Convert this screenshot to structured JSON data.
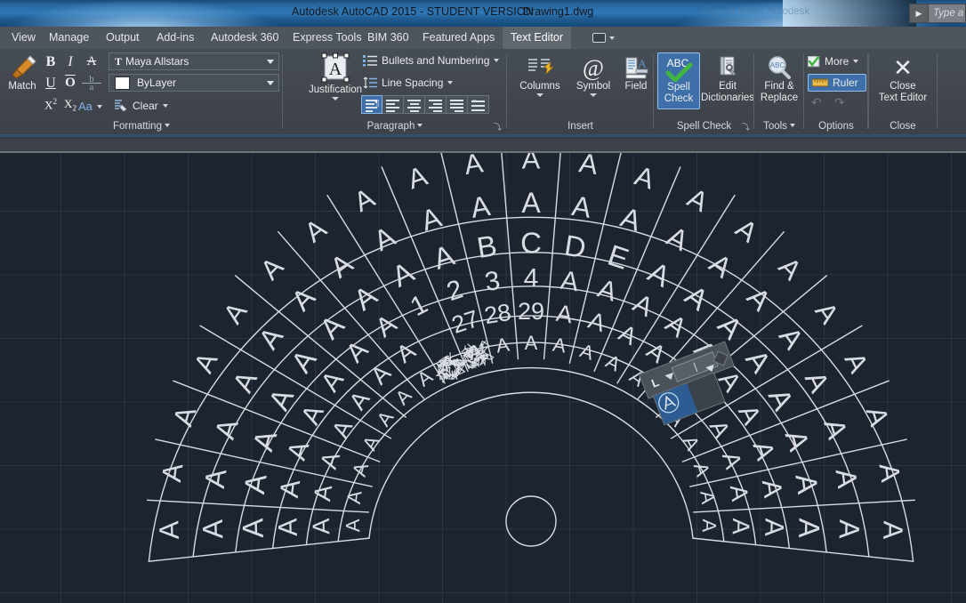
{
  "titlebar": {
    "app_title": "Autodesk AutoCAD 2015 - STUDENT VERSION",
    "document": "Drawing1.dwg",
    "ghost_text": "Sign In   Share   Autodesk",
    "search_placeholder": "Type a keyword or phrase",
    "expand_arrow": "▶"
  },
  "tabs": [
    {
      "label": "View",
      "active": false
    },
    {
      "label": "Manage",
      "active": false
    },
    {
      "label": "Output",
      "active": false
    },
    {
      "label": "Add-ins",
      "active": false
    },
    {
      "label": "Autodesk 360",
      "active": false
    },
    {
      "label": "Express Tools",
      "active": false
    },
    {
      "label": "BIM 360",
      "active": false
    },
    {
      "label": "Featured Apps",
      "active": false
    },
    {
      "label": "Text Editor",
      "active": true
    }
  ],
  "panels": {
    "formatting": {
      "title": "Formatting",
      "match_label": "Match",
      "bold": "B",
      "italic": "I",
      "strikethrough": "A",
      "underline": "U",
      "overline": "O",
      "stack": "b/a",
      "superscript_base": "X",
      "superscript_exp": "2",
      "subscript_base": "X",
      "subscript_exp": "2",
      "case_label": "Aa",
      "clear_label": "Clear",
      "font_value": "Maya Allstars",
      "font_icon": "T",
      "color_value": "ByLayer",
      "color_swatch": "#ffffff"
    },
    "paragraph": {
      "title": "Paragraph",
      "justification_label": "Justification",
      "justification_glyph": "A",
      "bullets_label": "Bullets and Numbering",
      "line_spacing_label": "Line Spacing",
      "align_buttons": [
        {
          "name": "justification-combined",
          "selected": true
        },
        {
          "name": "align-left",
          "selected": false
        },
        {
          "name": "align-center",
          "selected": false
        },
        {
          "name": "align-right",
          "selected": false
        },
        {
          "name": "align-justify",
          "selected": false
        },
        {
          "name": "align-distributed",
          "selected": false
        }
      ],
      "dialog_launcher": "⤵"
    },
    "insert": {
      "title": "Insert",
      "items": [
        {
          "label": "Columns",
          "icon": "columns-icon",
          "has_caret": true
        },
        {
          "label": "Symbol",
          "icon": "at-symbol-icon",
          "glyph": "@",
          "has_caret": true
        },
        {
          "label": "Field",
          "icon": "field-icon",
          "has_caret": false
        }
      ]
    },
    "spellcheck": {
      "title": "Spell Check",
      "spell_line1": "Spell",
      "spell_line2": "Check",
      "spell_badge": "ABC",
      "spell_tick": "✓",
      "spell_active": true,
      "dict_line1": "Edit",
      "dict_line2": "Dictionaries",
      "dialog_launcher": "⤵"
    },
    "tools": {
      "title": "Tools",
      "find_line1": "Find &",
      "find_line2": "Replace",
      "find_badge": "ABC"
    },
    "options": {
      "title": "Options",
      "more_label": "More",
      "ruler_label": "Ruler",
      "ruler_active": true,
      "undo_glyph": "↶",
      "redo_glyph": "↷"
    },
    "close": {
      "title": "Close",
      "line1": "Close",
      "line2": "Text Editor",
      "glyph": "✕"
    }
  },
  "canvas": {
    "background": "#1d2430",
    "grid_color": "#2b3544",
    "geometry_color": "#d8dde3",
    "center_circle": true,
    "rings": [
      {
        "index": 0,
        "labels": [
          "A",
          "A",
          "A",
          "A",
          "A",
          "A",
          "A",
          "A",
          "A",
          "A",
          "A",
          "A",
          "A",
          "A",
          "A",
          "A",
          "A",
          "A",
          "A",
          "A",
          "A"
        ]
      },
      {
        "index": 1,
        "labels": [
          "A",
          "A",
          "A",
          "A",
          "A",
          "A",
          "A",
          "░",
          "27",
          "28",
          "29",
          "A",
          "A",
          "A",
          "A",
          "A",
          "A",
          "A",
          "A",
          "A",
          "A"
        ]
      },
      {
        "index": 2,
        "labels": [
          "A",
          "A",
          "A",
          "A",
          "A",
          "A",
          "A",
          "1",
          "2",
          "3",
          "4",
          "A",
          "A",
          "A",
          "A",
          "A",
          "A",
          "A",
          "A",
          "A",
          "A"
        ]
      },
      {
        "index": 3,
        "labels": [
          "A",
          "A",
          "A",
          "A",
          "A",
          "A",
          "A",
          "A",
          "A",
          "B",
          "C",
          "D",
          "E",
          "A",
          "A",
          "A",
          "A",
          "A",
          "A",
          "A",
          "A"
        ]
      },
      {
        "index": 4,
        "labels": [
          "A",
          "A",
          "A",
          "A",
          "A",
          "A",
          "A",
          "A",
          "A",
          "A",
          "A",
          "A",
          "A",
          "A",
          "A",
          "A",
          "A",
          "A",
          "A",
          "A",
          "A"
        ]
      },
      {
        "index": 5,
        "labels": [
          "A",
          "A",
          "A",
          "A",
          "A",
          "A",
          "A",
          "A",
          "A",
          "A",
          "A",
          "A",
          "A",
          "A",
          "A",
          "A",
          "A",
          "A",
          "A",
          "A",
          "A"
        ]
      }
    ],
    "scribbles": 2
  },
  "mini_toolbar": {
    "left_label": "L",
    "field_value": "",
    "rotation_deg": -21,
    "accent_color": "#2c5c92"
  }
}
